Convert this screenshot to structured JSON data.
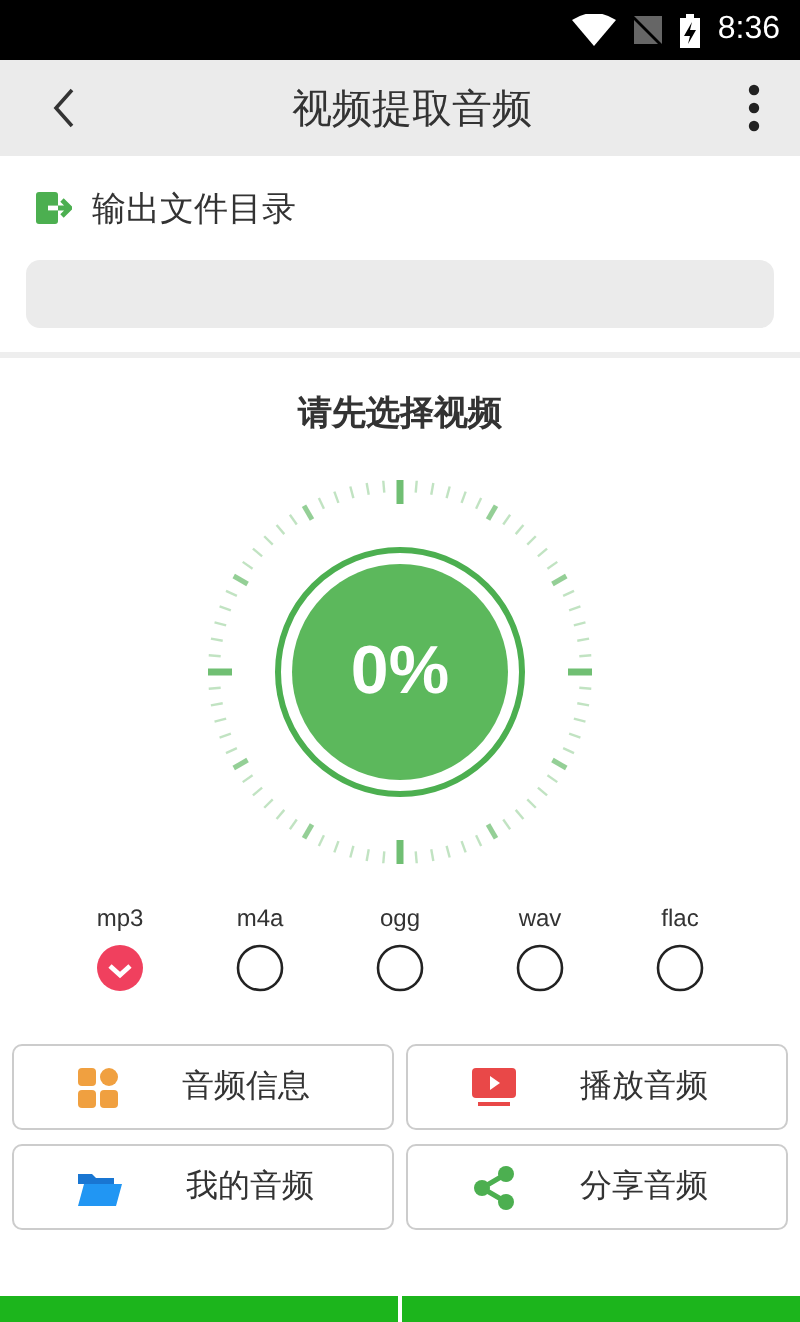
{
  "status_bar": {
    "time": "8:36"
  },
  "toolbar": {
    "title": "视频提取音频"
  },
  "output": {
    "label": "输出文件目录"
  },
  "prompt": "请先选择视频",
  "progress": {
    "text": "0%"
  },
  "formats": [
    {
      "label": "mp3",
      "selected": true
    },
    {
      "label": "m4a",
      "selected": false
    },
    {
      "label": "ogg",
      "selected": false
    },
    {
      "label": "wav",
      "selected": false
    },
    {
      "label": "flac",
      "selected": false
    }
  ],
  "actions": [
    {
      "label": "音频信息",
      "kind": "grid"
    },
    {
      "label": "播放音频",
      "kind": "play"
    },
    {
      "label": "我的音频",
      "kind": "folder"
    },
    {
      "label": "分享音频",
      "kind": "share"
    }
  ]
}
